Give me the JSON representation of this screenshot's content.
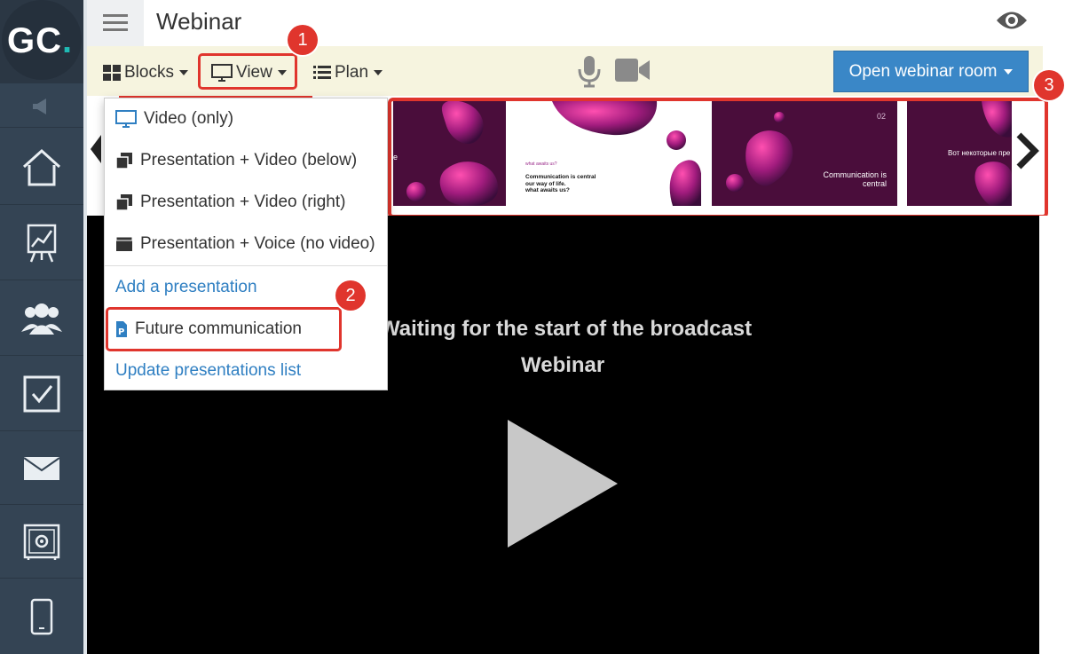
{
  "app": {
    "logo_letters": "GC",
    "logo_dot": "."
  },
  "header": {
    "title": "Webinar"
  },
  "sidebar": {
    "items": [
      {
        "icon": "megaphone-icon"
      },
      {
        "icon": "home-icon"
      },
      {
        "icon": "chart-board-icon"
      },
      {
        "icon": "users-icon"
      },
      {
        "icon": "checkbox-icon"
      },
      {
        "icon": "mail-icon"
      },
      {
        "icon": "safe-icon"
      },
      {
        "icon": "phone-icon"
      }
    ]
  },
  "toolbar": {
    "blocks_label": "Blocks",
    "view_label": "View",
    "plan_label": "Plan",
    "open_room_label": "Open webinar room"
  },
  "view_menu": {
    "items": [
      {
        "label": "Video (only)",
        "icon": "monitor-icon"
      },
      {
        "label": "Presentation + Video (below)",
        "icon": "copy-icon"
      },
      {
        "label": "Presentation + Video (right)",
        "icon": "copy-icon"
      },
      {
        "label": "Presentation + Voice (no video)",
        "icon": "window-icon"
      }
    ],
    "add_presentation": "Add a presentation",
    "presentation_name": "Future communication",
    "update_list": "Update presentations list"
  },
  "slides": [
    {
      "text": "e"
    },
    {
      "title": "what awaits us?",
      "body": "Communication is central\nour way of life.\nwhat awaits us?"
    },
    {
      "number": "02",
      "text": "Communication is\ncentral"
    },
    {
      "text": "Вот некоторые пре"
    }
  ],
  "video": {
    "status": "Waiting for the start of the broadcast",
    "title": "Webinar"
  },
  "annotations": {
    "badge1": "1",
    "badge2": "2",
    "badge3": "3"
  },
  "colors": {
    "sidebar": "#344454",
    "toolbar_bg": "#f6f4df",
    "accent_blue": "#3a87c7",
    "link_blue": "#2f7fc2",
    "annotation_red": "#e0352d",
    "logo_teal": "#1fbab4"
  }
}
